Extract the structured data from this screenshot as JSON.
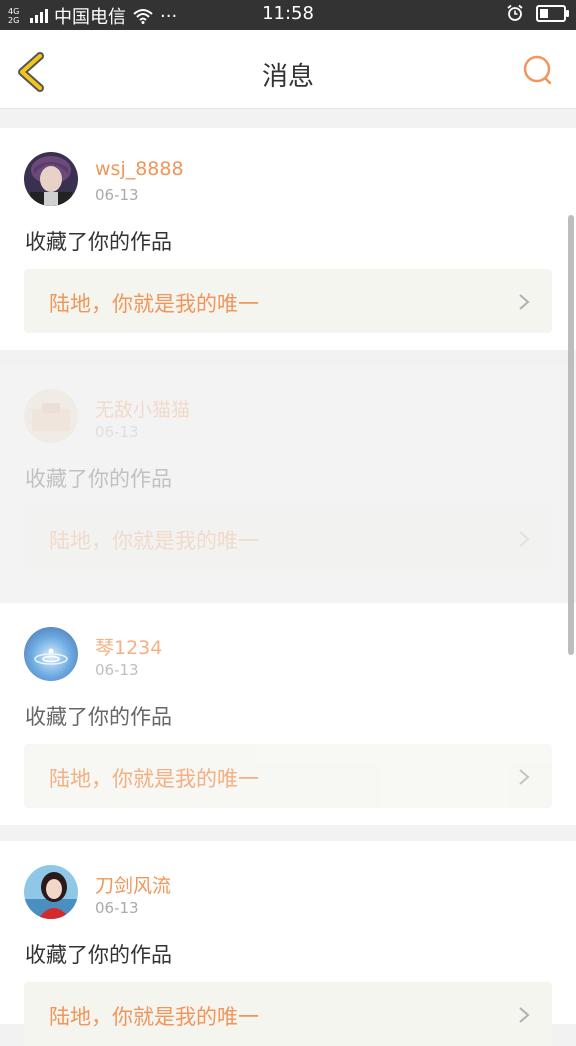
{
  "status_bar": {
    "carrier": "中国电信",
    "network_top": "4G",
    "network_bottom": "2G",
    "time": "11:58",
    "dots": "···"
  },
  "header": {
    "title": "消息"
  },
  "icons": {
    "back": "chevron-left-icon",
    "search": "search-icon"
  },
  "colors": {
    "accent": "#f0965a",
    "back_icon": "#f5c518"
  },
  "messages": [
    {
      "username": "wsj_8888",
      "date": "06-13",
      "action": "收藏了你的作品",
      "work_title": "陆地，你就是我的唯一"
    },
    {
      "username": "无敌小猫猫",
      "date": "06-13",
      "action": "收藏了你的作品",
      "work_title": "陆地，你就是我的唯一"
    },
    {
      "username": "琴1234",
      "date": "06-13",
      "action": "收藏了你的作品",
      "work_title": "陆地，你就是我的唯一"
    },
    {
      "username": "刀剑风流",
      "date": "06-13",
      "action": "收藏了你的作品",
      "work_title": "陆地，你就是我的唯一"
    }
  ]
}
